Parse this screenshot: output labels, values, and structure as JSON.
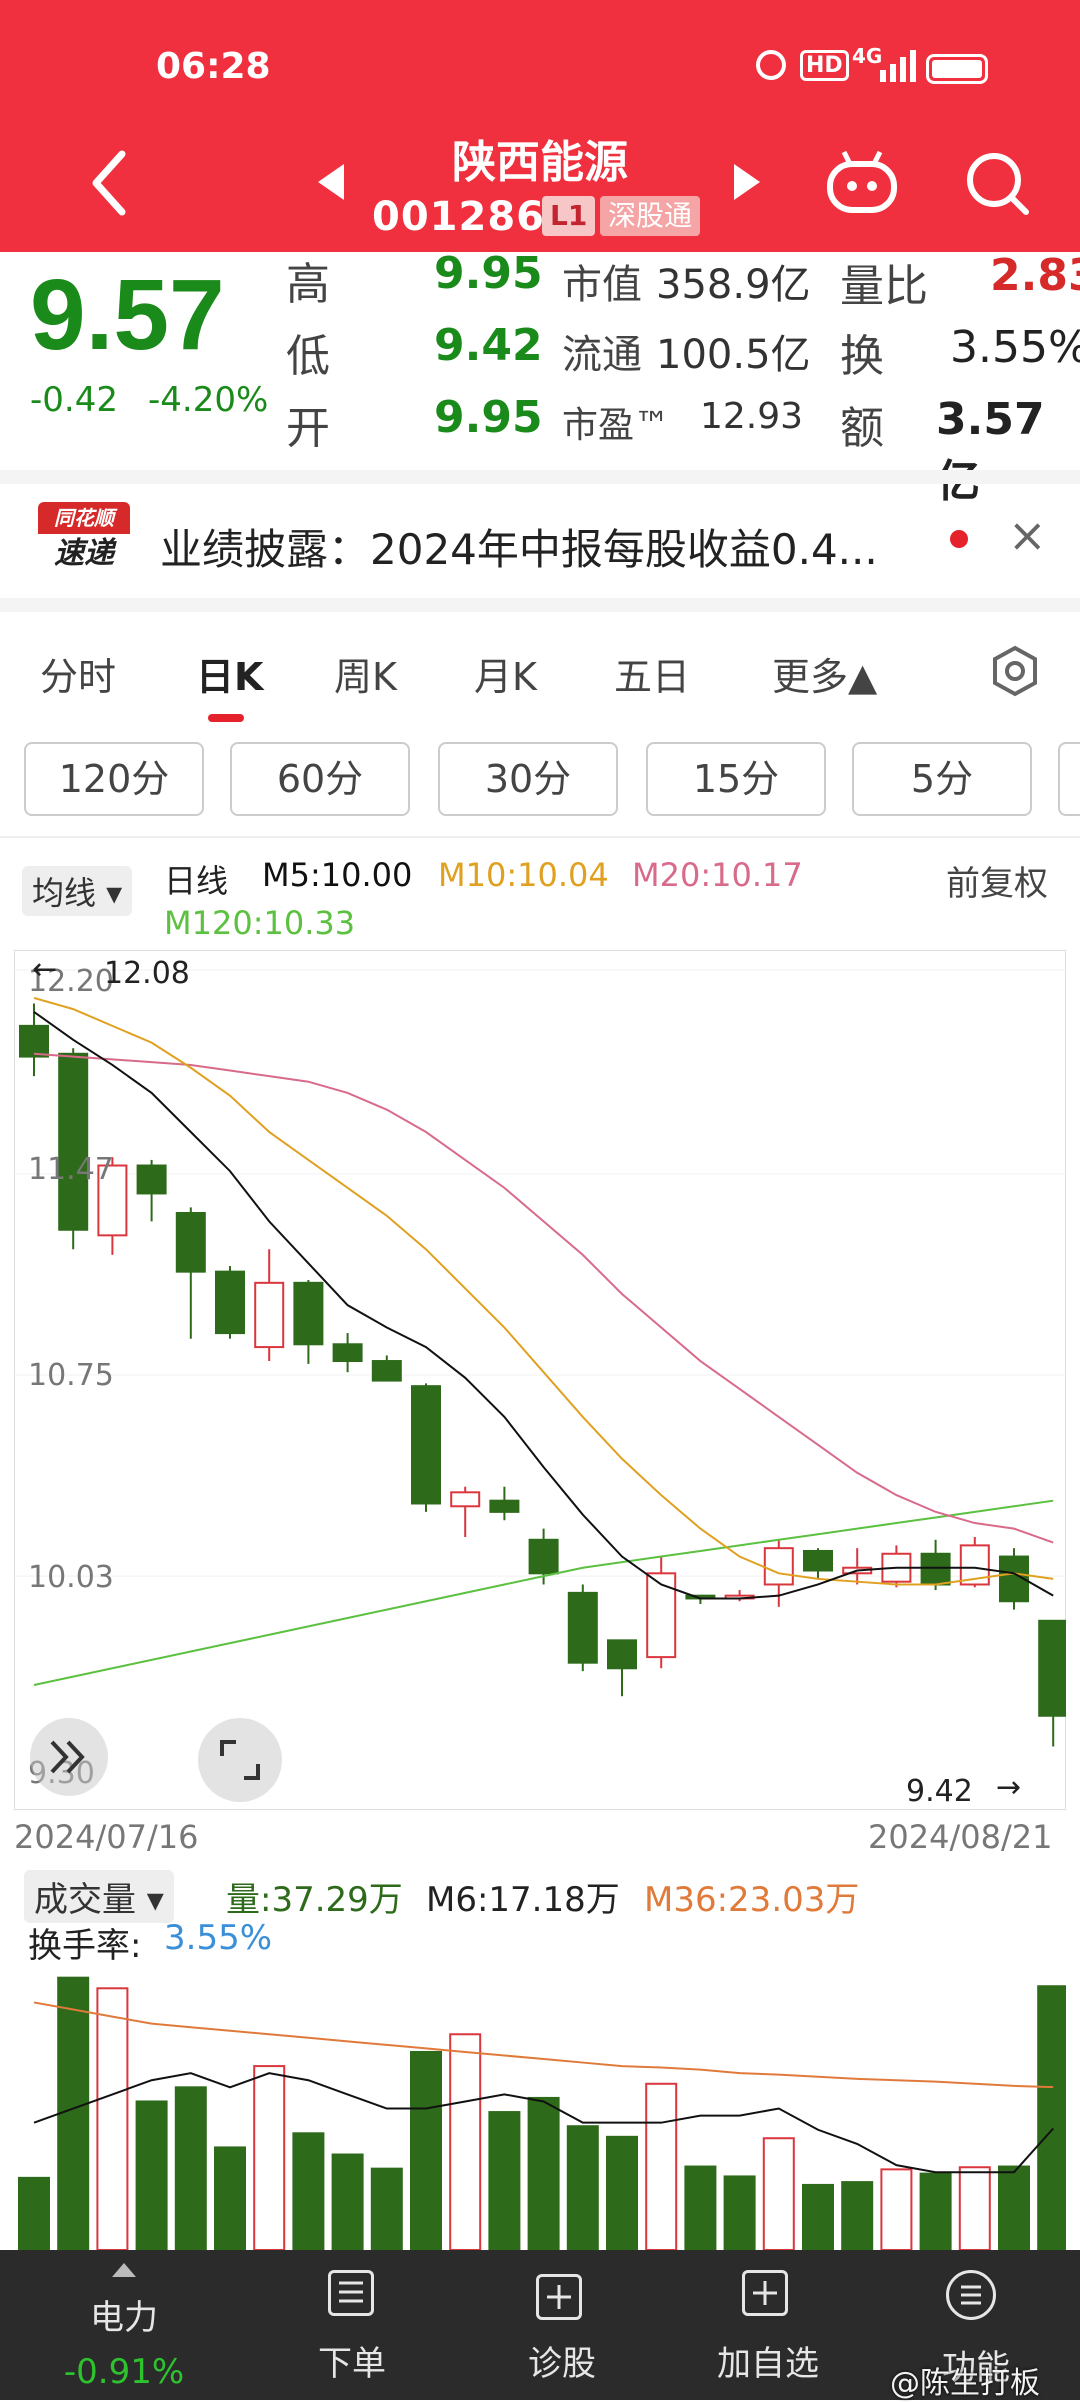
{
  "status_bar": {
    "time": "06:28",
    "hd": "HD",
    "network": "4G"
  },
  "header": {
    "title": "陕西能源",
    "code": "001286",
    "level": "L1",
    "exchange_tag": "深股通"
  },
  "quote": {
    "price": "9.57",
    "change": "-0.42",
    "change_pct": "-4.20%",
    "high_label": "高",
    "high": "9.95",
    "low_label": "低",
    "low": "9.42",
    "open_label": "开",
    "open": "9.95",
    "mcap_label": "市值",
    "mcap": "358.9亿",
    "float_label": "流通",
    "float": "100.5亿",
    "pe_label": "市盈™",
    "pe": "12.93",
    "vol_ratio_label": "量比",
    "vol_ratio": "2.83",
    "turnover_label": "换",
    "turnover": "3.55%",
    "amount_label": "额",
    "amount": "3.57亿"
  },
  "news": {
    "logo_top": "同花顺",
    "logo_bottom": "速递",
    "text": "业绩披露：2024年中报每股收益0.4...",
    "close": "×"
  },
  "tabs": [
    "分时",
    "日K",
    "周K",
    "月K",
    "五日",
    "更多▲"
  ],
  "active_tab": "日K",
  "period_buttons": [
    "120分",
    "60分",
    "30分",
    "15分",
    "5分"
  ],
  "ma_legend": {
    "selector": "均线 ▾",
    "type": "日线",
    "m5": "M5:10.00",
    "m10": "M10:10.04",
    "m20": "M20:10.17",
    "m120": "M120:10.33",
    "adjust": "前复权"
  },
  "colors": {
    "up": "#d9363e",
    "down": "#2d6a1a",
    "m5": "#111111",
    "m10": "#e0a020",
    "m20": "#d86a8a",
    "m120": "#5cc040"
  },
  "chart_data": [
    {
      "type": "candlestick",
      "y_ticks": [
        "12.20",
        "11.47",
        "10.75",
        "10.03",
        "9.30"
      ],
      "ylim": [
        9.3,
        12.2
      ],
      "x_start": "2024/07/16",
      "x_end": "2024/08/21",
      "high_marker": "12.08",
      "low_marker": "9.42",
      "candles": [
        {
          "o": 12.0,
          "h": 12.08,
          "l": 11.82,
          "c": 11.89
        },
        {
          "o": 11.9,
          "h": 11.92,
          "l": 11.2,
          "c": 11.27
        },
        {
          "o": 11.25,
          "h": 11.53,
          "l": 11.18,
          "c": 11.5
        },
        {
          "o": 11.5,
          "h": 11.52,
          "l": 11.3,
          "c": 11.4
        },
        {
          "o": 11.33,
          "h": 11.35,
          "l": 10.88,
          "c": 11.12
        },
        {
          "o": 11.12,
          "h": 11.14,
          "l": 10.88,
          "c": 10.9
        },
        {
          "o": 10.85,
          "h": 11.2,
          "l": 10.8,
          "c": 11.08
        },
        {
          "o": 11.08,
          "h": 11.09,
          "l": 10.79,
          "c": 10.86
        },
        {
          "o": 10.86,
          "h": 10.9,
          "l": 10.76,
          "c": 10.8
        },
        {
          "o": 10.8,
          "h": 10.82,
          "l": 10.73,
          "c": 10.73
        },
        {
          "o": 10.71,
          "h": 10.72,
          "l": 10.26,
          "c": 10.29
        },
        {
          "o": 10.28,
          "h": 10.35,
          "l": 10.17,
          "c": 10.33
        },
        {
          "o": 10.3,
          "h": 10.35,
          "l": 10.23,
          "c": 10.26
        },
        {
          "o": 10.16,
          "h": 10.2,
          "l": 10.0,
          "c": 10.04
        },
        {
          "o": 9.97,
          "h": 10.0,
          "l": 9.69,
          "c": 9.72
        },
        {
          "o": 9.8,
          "h": 9.8,
          "l": 9.6,
          "c": 9.7
        },
        {
          "o": 9.74,
          "h": 10.1,
          "l": 9.7,
          "c": 10.04
        },
        {
          "o": 9.96,
          "h": 9.96,
          "l": 9.93,
          "c": 9.95
        },
        {
          "o": 9.95,
          "h": 9.98,
          "l": 9.94,
          "c": 9.96
        },
        {
          "o": 10.0,
          "h": 10.16,
          "l": 9.92,
          "c": 10.13
        },
        {
          "o": 10.12,
          "h": 10.13,
          "l": 10.02,
          "c": 10.05
        },
        {
          "o": 10.04,
          "h": 10.13,
          "l": 10.0,
          "c": 10.06
        },
        {
          "o": 10.01,
          "h": 10.14,
          "l": 9.99,
          "c": 10.11
        },
        {
          "o": 10.11,
          "h": 10.16,
          "l": 9.98,
          "c": 10.0
        },
        {
          "o": 10.0,
          "h": 10.17,
          "l": 9.99,
          "c": 10.14
        },
        {
          "o": 10.1,
          "h": 10.13,
          "l": 9.91,
          "c": 9.94
        },
        {
          "o": 9.87,
          "h": 9.87,
          "l": 9.42,
          "c": 9.53
        }
      ],
      "ma5": [
        12.05,
        11.95,
        11.86,
        11.76,
        11.62,
        11.48,
        11.3,
        11.15,
        11.0,
        10.92,
        10.85,
        10.74,
        10.6,
        10.42,
        10.25,
        10.1,
        10.0,
        9.95,
        9.95,
        9.96,
        10.0,
        10.05,
        10.06,
        10.06,
        10.06,
        10.04,
        9.96
      ],
      "ma10": [
        12.1,
        12.06,
        12.0,
        11.94,
        11.85,
        11.75,
        11.62,
        11.52,
        11.42,
        11.32,
        11.2,
        11.06,
        10.92,
        10.76,
        10.6,
        10.45,
        10.32,
        10.2,
        10.1,
        10.04,
        10.02,
        10.01,
        10.0,
        10.0,
        10.02,
        10.04,
        10.02
      ],
      "ma20": [
        11.9,
        11.89,
        11.88,
        11.87,
        11.86,
        11.84,
        11.82,
        11.8,
        11.76,
        11.7,
        11.62,
        11.52,
        11.42,
        11.3,
        11.18,
        11.04,
        10.92,
        10.8,
        10.7,
        10.6,
        10.5,
        10.4,
        10.32,
        10.26,
        10.22,
        10.2,
        10.15
      ],
      "ma120": [
        9.64,
        9.67,
        9.7,
        9.73,
        9.76,
        9.79,
        9.82,
        9.85,
        9.88,
        9.91,
        9.94,
        9.97,
        10.0,
        10.03,
        10.06,
        10.08,
        10.1,
        10.12,
        10.14,
        10.16,
        10.18,
        10.2,
        10.22,
        10.24,
        10.26,
        10.28,
        10.3
      ]
    },
    {
      "type": "bar",
      "title": "成交量",
      "legend": {
        "vol": "量:37.29万",
        "m6": "M6:17.18万",
        "m36": "M36:23.03万",
        "turnover_label": "换手率:",
        "turnover": "3.55%"
      },
      "volumes": [
        10.2,
        38.5,
        37.0,
        21.0,
        23.0,
        14.5,
        26.0,
        16.5,
        13.5,
        11.5,
        28.0,
        30.5,
        19.5,
        21.5,
        17.5,
        16.0,
        23.5,
        11.8,
        10.4,
        15.8,
        9.2,
        9.6,
        11.4,
        10.8,
        11.7,
        11.8,
        37.29
      ],
      "up_days": [
        false,
        false,
        true,
        false,
        false,
        false,
        true,
        false,
        false,
        false,
        false,
        true,
        false,
        false,
        false,
        false,
        true,
        false,
        false,
        true,
        false,
        false,
        true,
        false,
        true,
        false,
        false
      ],
      "m6": [
        18,
        20,
        22,
        24,
        25,
        23,
        25,
        24,
        22,
        20,
        20,
        21,
        22,
        21,
        18,
        18,
        18,
        19,
        19,
        20,
        17,
        15,
        12,
        11,
        11,
        11,
        17.18
      ],
      "m36": [
        35,
        34,
        33,
        32,
        31.5,
        31,
        30.5,
        30,
        29.5,
        29,
        28.5,
        28,
        27.5,
        27,
        26.5,
        26,
        25.8,
        25.5,
        25,
        24.8,
        24.5,
        24.2,
        24,
        23.8,
        23.5,
        23.2,
        23.03
      ]
    }
  ],
  "bottom_nav": {
    "sector_name": "电力",
    "sector_change": "-0.91%",
    "items": [
      "下单",
      "诊股",
      "加自选",
      "功能"
    ],
    "watermark": "@陈生打板"
  }
}
